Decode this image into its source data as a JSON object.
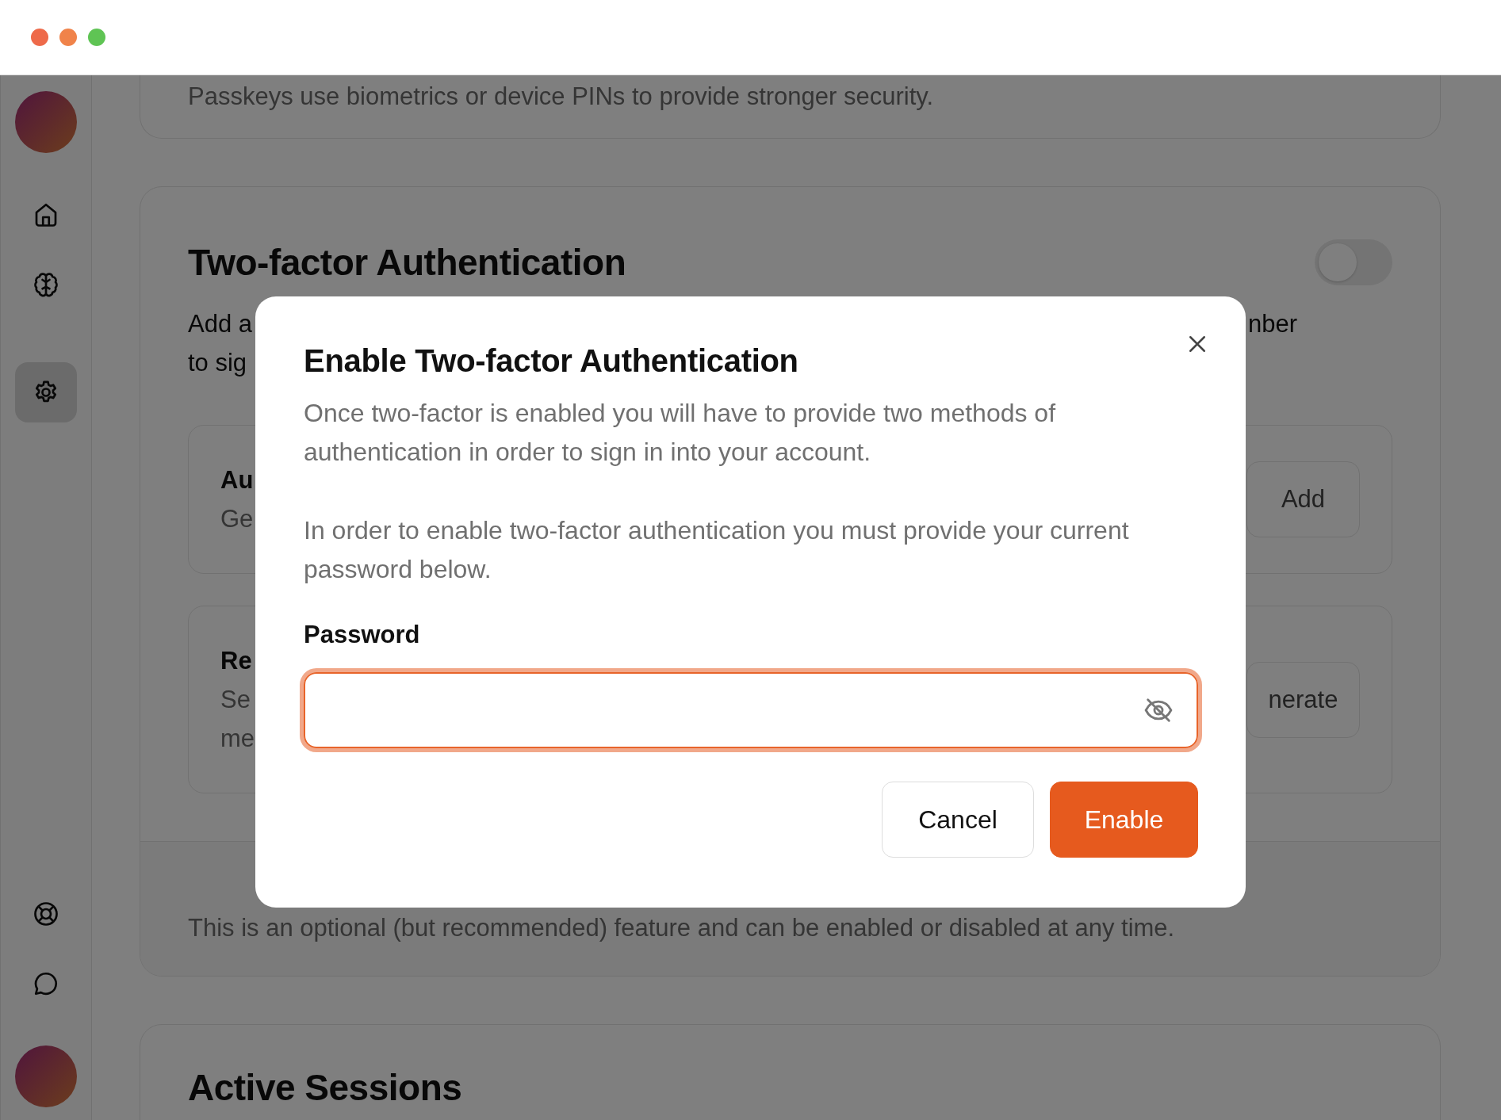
{
  "sidebar": {
    "top_items": [
      {
        "selected": false
      },
      {
        "selected": false
      },
      {
        "selected": true
      }
    ],
    "bottom_items": [
      {
        "selected": false
      },
      {
        "selected": false
      }
    ]
  },
  "passkeys_card": {
    "description": "Passkeys use biometrics or device PINs to provide stronger security."
  },
  "two_factor_card": {
    "title": "Two-factor Authentication",
    "on": false,
    "description_lines": [
      {
        "start": "Add a",
        "end": "nber"
      },
      {
        "start": "to sig"
      }
    ],
    "methods": [
      {
        "title": "Au",
        "subtitle_lines": [
          "Ge"
        ],
        "button": "Add"
      },
      {
        "title": "Re",
        "subtitle_lines": [
          "Se",
          "me"
        ],
        "button": "nerate"
      }
    ],
    "footer": "This is an optional (but recommended) feature and can be enabled or disabled at any time."
  },
  "sessions_card": {
    "title": "Active Sessions"
  },
  "dialog": {
    "title": "Enable Two-factor Authentication",
    "paragraphs": [
      "Once two-factor is enabled you will have to provide two methods of authentication in order to sign in into your account.",
      "In order to enable two-factor authentication you must provide your current password below."
    ],
    "password_label": "Password",
    "password_hidden": true,
    "cancel_button": "Cancel",
    "confirm_button": "Enable"
  }
}
